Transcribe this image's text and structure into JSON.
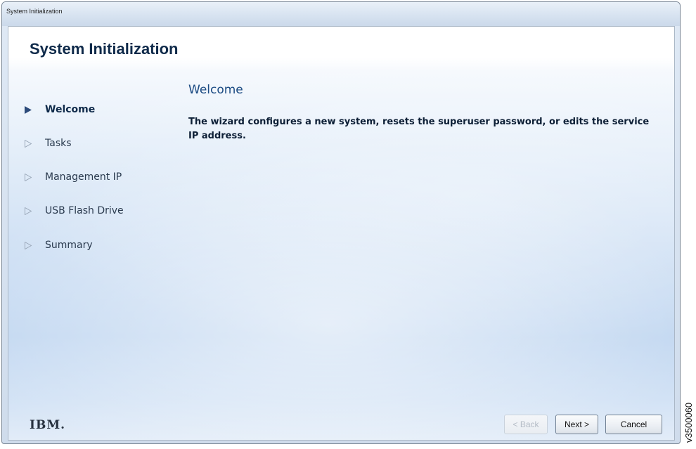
{
  "window": {
    "title": "System Initialization"
  },
  "header": {
    "app_title": "System Initialization"
  },
  "nav": {
    "items": [
      {
        "label": "Welcome",
        "active": true,
        "icon": "arrow-right-filled-icon"
      },
      {
        "label": "Tasks",
        "active": false,
        "icon": "arrow-right-outline-icon"
      },
      {
        "label": "Management IP",
        "active": false,
        "icon": "arrow-right-outline-icon"
      },
      {
        "label": "USB Flash Drive",
        "active": false,
        "icon": "arrow-right-outline-icon"
      },
      {
        "label": "Summary",
        "active": false,
        "icon": "arrow-right-outline-icon"
      }
    ]
  },
  "content": {
    "title": "Welcome",
    "description": "The wizard configures a new system, resets the superuser password, or edits the service IP address."
  },
  "footer": {
    "logo": "IBM.",
    "back_label": "< Back",
    "next_label": "Next >",
    "cancel_label": "Cancel"
  },
  "figure_id": "v3500060",
  "colors": {
    "active_arrow": "#2c4a7a",
    "inactive_arrow": "#9aa7b8",
    "title_text": "#0f2a4a",
    "content_title": "#1a4a82"
  }
}
